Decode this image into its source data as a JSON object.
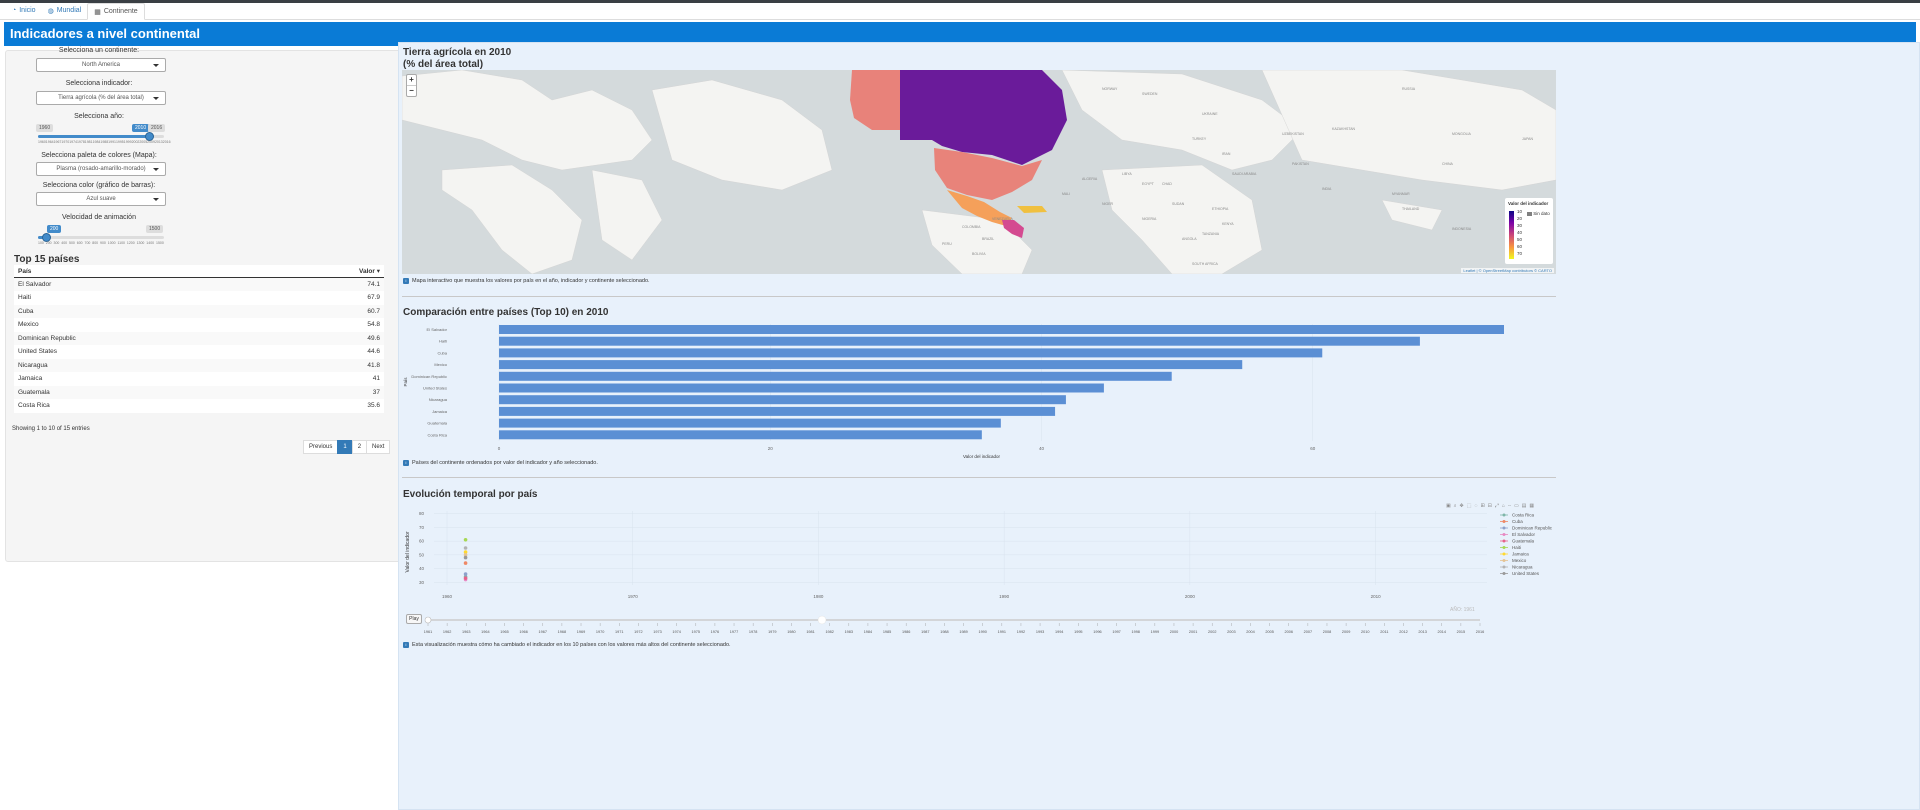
{
  "tabs": [
    {
      "label": "Inicio",
      "icon": "play-circle-icon"
    },
    {
      "label": "Mundial",
      "icon": "globe-icon"
    },
    {
      "label": "Continente",
      "icon": "table-icon"
    }
  ],
  "app_title": "Indicadores a nivel continental",
  "sidebar": {
    "continent_label": "Selecciona un continente:",
    "continent_value": "North America",
    "indicator_label": "Selecciona indicador:",
    "indicator_value": "Tierra agrícola (% del área total)",
    "year_label": "Selecciona año:",
    "year_min": "1960",
    "year_value": "2010",
    "year_max": "2016",
    "year_fraction": 0.89,
    "year_ticks": [
      "1960",
      "1964",
      "1967",
      "1970",
      "1974",
      "1978",
      "1981",
      "1984",
      "1988",
      "1991",
      "1995",
      "1999",
      "2002",
      "2005",
      "2009",
      "2013",
      "2016"
    ],
    "palette_label": "Selecciona paleta de colores (Mapa):",
    "palette_value": "Plasma (rosado-amarillo-morado)",
    "barcolor_label": "Selecciona color (gráfico de barras):",
    "barcolor_value": "Azul suave",
    "speed_label": "Velocidad de animación",
    "speed_value": "200",
    "speed_max": "1500",
    "speed_fraction": 0.07,
    "speed_ticks": [
      "100",
      "200",
      "300",
      "400",
      "500",
      "600",
      "700",
      "800",
      "900",
      "1000",
      "1100",
      "1200",
      "1300",
      "1400",
      "1500"
    ]
  },
  "top15": {
    "title": "Top 15 países",
    "col_country": "País",
    "col_value": "Valor",
    "rows": [
      {
        "country": "El Salvador",
        "value": "74.1"
      },
      {
        "country": "Haiti",
        "value": "67.9"
      },
      {
        "country": "Cuba",
        "value": "60.7"
      },
      {
        "country": "Mexico",
        "value": "54.8"
      },
      {
        "country": "Dominican Republic",
        "value": "49.6"
      },
      {
        "country": "United States",
        "value": "44.6"
      },
      {
        "country": "Nicaragua",
        "value": "41.8"
      },
      {
        "country": "Jamaica",
        "value": "41"
      },
      {
        "country": "Guatemala",
        "value": "37"
      },
      {
        "country": "Costa Rica",
        "value": "35.6"
      }
    ],
    "info": "Showing 1 to 10 of 15 entries",
    "prev": "Previous",
    "page1": "1",
    "page2": "2",
    "next": "Next"
  },
  "map_section": {
    "title_line1": "Tierra agrícola en 2010",
    "title_line2": "(% del área total)",
    "zoom_in": "+",
    "zoom_out": "−",
    "legend_title": "Valor del indicador",
    "legend_nodata": "Sin dato",
    "legend_ticks": [
      "10",
      "20",
      "30",
      "40",
      "50",
      "60",
      "70"
    ],
    "attribution": "Leaflet | © OpenStreetMap contributors © CARTO",
    "caption": "Mapa interactivo que muestra los valores por país en el año, indicador y continente seleccionado.",
    "country_labels": [
      {
        "name": "RUSSIA"
      },
      {
        "name": "KAZAKHSTAN"
      },
      {
        "name": "MONGOLIA"
      },
      {
        "name": "CHINA"
      },
      {
        "name": "INDIA"
      },
      {
        "name": "IRAN"
      },
      {
        "name": "TURKEY"
      },
      {
        "name": "EGYPT"
      },
      {
        "name": "LIBYA"
      },
      {
        "name": "ALGERIA"
      },
      {
        "name": "NIGER"
      },
      {
        "name": "SUDAN"
      },
      {
        "name": "CHAD"
      },
      {
        "name": "MALI"
      },
      {
        "name": "ANGOLA"
      },
      {
        "name": "SAUDI ARABIA"
      },
      {
        "name": "PAKISTAN"
      },
      {
        "name": "UKRAINE"
      },
      {
        "name": "SWEDEN"
      },
      {
        "name": "NORWAY"
      },
      {
        "name": "BRAZIL"
      },
      {
        "name": "PERU"
      },
      {
        "name": "BOLIVIA"
      },
      {
        "name": "COLOMBIA"
      },
      {
        "name": "VENEZUELA"
      },
      {
        "name": "ETHIOPIA"
      },
      {
        "name": "KENYA"
      },
      {
        "name": "TANZANIA"
      },
      {
        "name": "NIGERIA"
      },
      {
        "name": "MYANMAR"
      },
      {
        "name": "THAILAND"
      },
      {
        "name": "INDONESIA"
      },
      {
        "name": "JAPAN"
      },
      {
        "name": "UZBEKISTAN"
      },
      {
        "name": "SOUTH AFRICA"
      }
    ]
  },
  "bar_section": {
    "title": "Comparación entre países (Top 10) en 2010",
    "caption": "Países del continente ordenados por valor del indicador y año seleccionado.",
    "bar_color": "#5b8fd4",
    "chart_data": {
      "type": "bar",
      "categories": [
        "El Salvador",
        "Haiti",
        "Cuba",
        "Mexico",
        "Dominican Republic",
        "United States",
        "Nicaragua",
        "Jamaica",
        "Guatemala",
        "Costa Rica"
      ],
      "values": [
        74.1,
        67.9,
        60.7,
        54.8,
        49.6,
        44.6,
        41.8,
        41,
        37,
        35.6
      ],
      "xlabel": "Valor del indicador",
      "ylabel": "País",
      "xticks": [
        "0",
        "20",
        "40",
        "60"
      ],
      "xlim": [
        0,
        74.1
      ]
    }
  },
  "line_section": {
    "title": "Evolución temporal por país",
    "caption": "Esta visualización muestra cómo ha cambiado el indicador en los 10 países con los valores más altos del continente seleccionado.",
    "play": "Play",
    "frame_label": "AÑO: 1961",
    "chart_data": {
      "type": "scatter",
      "xlabel": "Año",
      "ylabel": "Valor del indicador",
      "xticks": [
        "1960",
        "1970",
        "1980",
        "1990",
        "2000",
        "2010"
      ],
      "yticks": [
        "30",
        "40",
        "50",
        "60",
        "70",
        "80"
      ],
      "xlim": [
        1959.3,
        2016
      ],
      "ylim": [
        28,
        82
      ],
      "series": [
        {
          "name": "Costa Rica",
          "color": "#7fb6a8",
          "values": [
            {
              "x": 1961,
              "y": 34
            }
          ]
        },
        {
          "name": "Cuba",
          "color": "#ee8866",
          "values": [
            {
              "x": 1961,
              "y": 44
            }
          ]
        },
        {
          "name": "Dominican Republic",
          "color": "#8da0cb",
          "values": [
            {
              "x": 1961,
              "y": 36
            }
          ]
        },
        {
          "name": "El Salvador",
          "color": "#e78ac3",
          "values": [
            {
              "x": 1961,
              "y": 32
            }
          ]
        },
        {
          "name": "Guatemala",
          "color": "#e7628a",
          "values": [
            {
              "x": 1961,
              "y": 33
            }
          ]
        },
        {
          "name": "Haiti",
          "color": "#a6d854",
          "values": [
            {
              "x": 1961,
              "y": 61
            }
          ]
        },
        {
          "name": "Jamaica",
          "color": "#ffd92f",
          "values": [
            {
              "x": 1961,
              "y": 52
            }
          ]
        },
        {
          "name": "Mexico",
          "color": "#e5c494",
          "values": [
            {
              "x": 1961,
              "y": 50
            }
          ]
        },
        {
          "name": "Nicaragua",
          "color": "#b3b3b3",
          "values": [
            {
              "x": 1961,
              "y": 55
            }
          ]
        },
        {
          "name": "United States",
          "color": "#999999",
          "values": [
            {
              "x": 1961,
              "y": 48
            }
          ]
        }
      ],
      "frame_years": [
        "1961",
        "1962",
        "1963",
        "1964",
        "1965",
        "1966",
        "1967",
        "1968",
        "1969",
        "1970",
        "1971",
        "1972",
        "1973",
        "1974",
        "1975",
        "1976",
        "1977",
        "1978",
        "1979",
        "1980",
        "1981",
        "1982",
        "1983",
        "1984",
        "1985",
        "1986",
        "1987",
        "1988",
        "1989",
        "1990",
        "1991",
        "1992",
        "1993",
        "1994",
        "1995",
        "1996",
        "1997",
        "1998",
        "1999",
        "2000",
        "2001",
        "2002",
        "2003",
        "2004",
        "2005",
        "2006",
        "2007",
        "2008",
        "2009",
        "2010",
        "2011",
        "2012",
        "2013",
        "2014",
        "2015",
        "2016"
      ]
    }
  }
}
